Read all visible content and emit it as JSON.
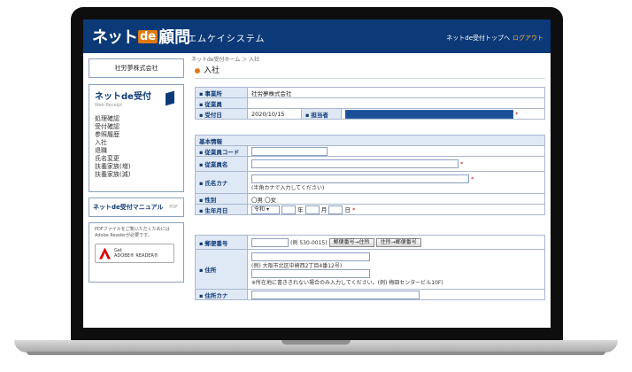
{
  "header": {
    "logo_net": "ネット",
    "logo_de": "de",
    "logo_komon": "顧問",
    "company": "エムケイシステム",
    "top_link": "ネットde受付トップへ",
    "logout": "ログアウト"
  },
  "sidebar": {
    "company_name": "社労夢株式会社",
    "app_title": "ネットde受付",
    "app_sub": "Web Receipt",
    "menu": [
      "処理確認",
      "受付確認",
      "参照履歴",
      "入社",
      "退職",
      "氏名変更",
      "扶養家族(増)",
      "扶養家族(減)"
    ],
    "manual": "ネットde受付マニュアル",
    "manual_pdf": "PDF",
    "adobe_note": "PDFファイルをご覧いただくためには Adobe Readerが必要です。",
    "adobe_get": "Get",
    "adobe_reader": "ADOBE® READER®"
  },
  "breadcrumb": "ネットde受付ホーム ＞ 入社",
  "page_title": "入社",
  "form": {
    "office_label": "事業所",
    "office_value": "社労夢株式会社",
    "employee_label": "従業員",
    "date_label": "受付日",
    "date_value": "2020/10/15",
    "staff_label": "担当者",
    "section_basic": "基本情報",
    "code_label": "従業員コード",
    "name_label": "従業員名",
    "kana_label": "氏名カナ",
    "kana_note": "(半角カナで入力してください)",
    "gender_label": "性別",
    "gender_male": "〇男",
    "gender_female": "〇女",
    "birth_label": "生年月日",
    "era_value": "令和",
    "year_unit": "年",
    "month_unit": "月",
    "day_unit": "日",
    "zip_label": "郵便番号",
    "zip_example": "(例 530-0015)",
    "zip_to_addr": "郵便番号→住所",
    "addr_to_zip": "住所→郵便番号",
    "addr_label": "住所",
    "addr_example": "(例) 大阪市北区中崎西2丁目4番12号)",
    "addr_note": "※所在地に書ききれない場合のみ入力してください。(例) 梅田センタービル10F)",
    "addr_kana_label": "住所カナ",
    "required_mark": "*"
  },
  "colors": {
    "header": "#0c3a78",
    "label_bg": "#dfe8f5",
    "accent": "#e07a10",
    "required": "#dd0000"
  }
}
